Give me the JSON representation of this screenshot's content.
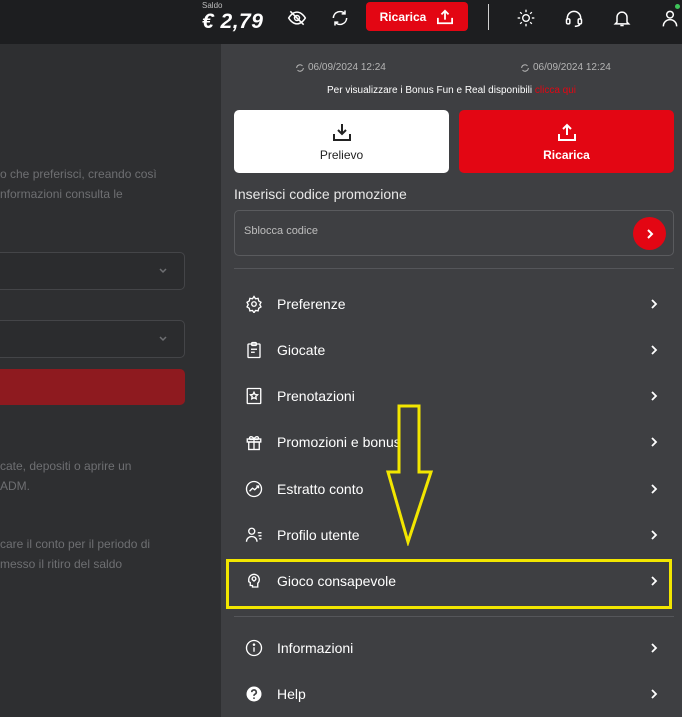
{
  "header": {
    "saldo_label": "Saldo",
    "saldo_value": "€ 2,79",
    "ricarica_label": "Ricarica",
    "icons": [
      "eye-off-icon",
      "refresh-icon",
      "upload-icon",
      "sun-icon",
      "headset-icon",
      "bell-icon",
      "user-icon"
    ],
    "online_color": "#3fc55a"
  },
  "left": {
    "line1": "o che preferisci, creando così",
    "line2": "nformazioni consulta le",
    "line3": "cate, depositi o aprire un",
    "line4": "ADM.",
    "line5": "care il conto per il periodo di",
    "line6": "messo il ritiro del saldo"
  },
  "drawer": {
    "sync_left": "06/09/2024 12:24",
    "sync_right": "06/09/2024 12:24",
    "bonus_text": "Per visualizzare i Bonus Fun e Real disponibili",
    "bonus_link": "clicca qui",
    "prelievo_label": "Prelievo",
    "ricarica_label": "Ricarica",
    "promo_title": "Inserisci codice promozione",
    "promo_placeholder": "Sblocca codice",
    "menu": [
      {
        "label": "Preferenze",
        "icon": "gear-icon"
      },
      {
        "label": "Giocate",
        "icon": "clipboard-icon"
      },
      {
        "label": "Prenotazioni",
        "icon": "bookmark-star-icon"
      },
      {
        "label": "Promozioni e bonus",
        "icon": "gift-icon"
      },
      {
        "label": "Estratto conto",
        "icon": "chart-trend-icon"
      },
      {
        "label": "Profilo utente",
        "icon": "user-list-icon"
      },
      {
        "label": "Gioco consapevole",
        "icon": "head-bulb-icon"
      },
      {
        "label": "Informazioni",
        "icon": "info-icon"
      },
      {
        "label": "Help",
        "icon": "help-icon"
      }
    ]
  },
  "colors": {
    "accent": "#e30613",
    "highlight": "#f2e600",
    "drawer_bg": "#3e3f42",
    "topbar_bg": "#1d1e20"
  }
}
